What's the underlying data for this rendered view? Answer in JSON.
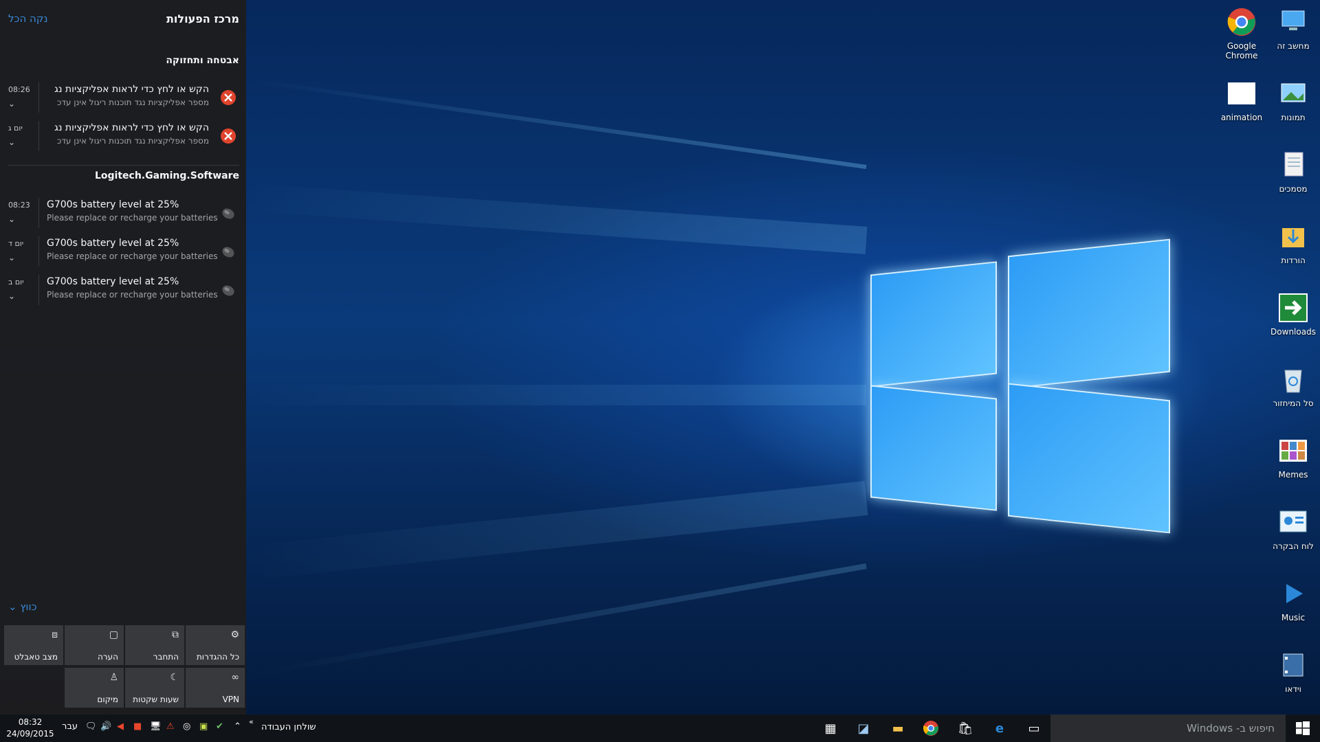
{
  "action_center": {
    "title": "מרכז הפעולות",
    "clear_all": "נקה הכל",
    "groups": [
      {
        "name": "אבטחה ותחזוקה",
        "items": [
          {
            "time": "08:26",
            "title": "הקש או לחץ כדי לראות אפליקציות נג",
            "body": "מספר אפליקציות נגד תוכנות ריגול אינן עדכ"
          },
          {
            "time": "יום ג",
            "title": "הקש או לחץ כדי לראות אפליקציות נג",
            "body": "מספר אפליקציות נגד תוכנות ריגול אינן עדכ"
          }
        ]
      },
      {
        "name": "Logitech.Gaming.Software",
        "items": [
          {
            "time": "08:23",
            "title": "G700s battery level at 25%",
            "body": "Please replace or recharge your batteries"
          },
          {
            "time": "יום ד",
            "title": "G700s battery level at 25%",
            "body": "Please replace or recharge your batteries"
          },
          {
            "time": "יום ב",
            "title": "G700s battery level at 25%",
            "body": "Please replace or recharge your batteries"
          }
        ]
      }
    ],
    "collapse_label": "כווץ",
    "quick_actions": [
      {
        "label": "כל ההגדרות",
        "icon": "gear-icon",
        "glyph": "⚙"
      },
      {
        "label": "התחבר",
        "icon": "connect-icon",
        "glyph": "⧉"
      },
      {
        "label": "הערה",
        "icon": "note-icon",
        "glyph": "▢"
      },
      {
        "label": "מצב טאבלט",
        "icon": "tablet-mode-icon",
        "glyph": "⧈"
      },
      {
        "label": "VPN",
        "icon": "vpn-icon",
        "glyph": "∞"
      },
      {
        "label": "שעות שקטות",
        "icon": "moon-icon",
        "glyph": "☾"
      },
      {
        "label": "מיקום",
        "icon": "location-icon",
        "glyph": "♙"
      }
    ]
  },
  "desktop_icons": [
    {
      "label": "מחשב זה",
      "icon": "this-pc-icon"
    },
    {
      "label": "Google Chrome",
      "icon": "chrome-icon"
    },
    {
      "label": "תמונות",
      "icon": "pictures-icon"
    },
    {
      "label": "animation",
      "icon": "animation-icon"
    },
    {
      "label": "מסמכים",
      "icon": "documents-icon"
    },
    {
      "label": "הורדות",
      "icon": "downloads-folder-icon"
    },
    {
      "label": "Downloads",
      "icon": "downloads-shortcut-icon"
    },
    {
      "label": "סל המיחזור",
      "icon": "recycle-bin-icon"
    },
    {
      "label": "Memes",
      "icon": "memes-icon"
    },
    {
      "label": "לוח הבקרה",
      "icon": "control-panel-icon"
    },
    {
      "label": "Music",
      "icon": "music-icon"
    },
    {
      "label": "וידאו",
      "icon": "video-icon"
    }
  ],
  "taskbar": {
    "search_placeholder": "חיפוש ב- Windows",
    "desktop_label": "שולחן העבודה",
    "clock_time": "08:32",
    "clock_date": "24/09/2015",
    "language": "עבר",
    "pinned": [
      "calculator-icon",
      "notes-app-icon",
      "file-explorer-icon",
      "chrome-icon",
      "store-icon",
      "edge-icon",
      "task-view-icon"
    ]
  },
  "colors": {
    "accent": "#3b8ee0",
    "error": "#e8452c",
    "panel": "#1d1d1f",
    "taskbar": "#101418"
  }
}
